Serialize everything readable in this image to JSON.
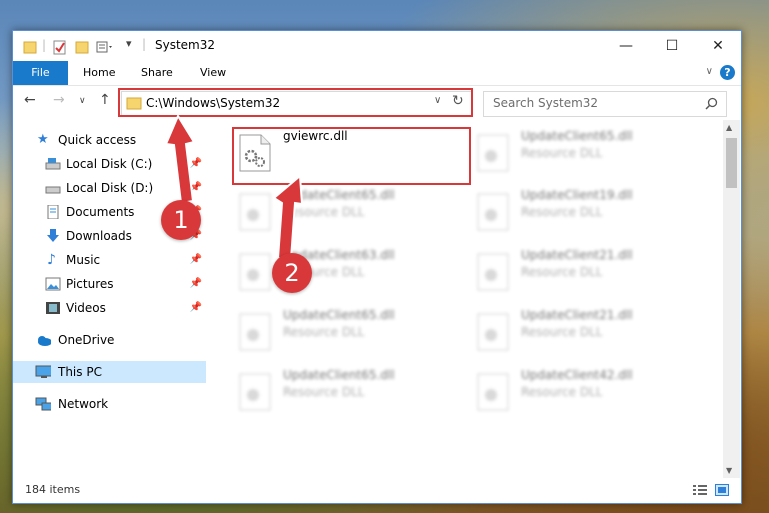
{
  "window": {
    "title": "System32"
  },
  "ribbon": {
    "file": "File",
    "tabs": [
      "Home",
      "Share",
      "View"
    ],
    "help": "?"
  },
  "address": {
    "path": "C:\\Windows\\System32"
  },
  "search": {
    "placeholder": "Search System32"
  },
  "sidebar": {
    "quick_access": "Quick access",
    "items": [
      "Local Disk (C:)",
      "Local Disk (D:)",
      "Documents",
      "Downloads",
      "Music",
      "Pictures",
      "Videos"
    ],
    "onedrive": "OneDrive",
    "this_pc": "This PC",
    "network": "Network"
  },
  "files": {
    "highlighted": {
      "name": "gviewrc.dll"
    },
    "blurred_col1": [
      {
        "name": "UpdateClient65.dll",
        "type": "Resource DLL"
      },
      {
        "name": "UpdateClient63.dll",
        "type": "Resource DLL"
      },
      {
        "name": "UpdateClient65.dll",
        "type": "Resource DLL"
      },
      {
        "name": "UpdateClient65.dll",
        "type": "Resource DLL"
      }
    ],
    "blurred_col2": [
      {
        "name": "UpdateClient65.dll",
        "type": "Resource DLL"
      },
      {
        "name": "UpdateClient19.dll",
        "type": "Resource DLL"
      },
      {
        "name": "UpdateClient21.dll",
        "type": "Resource DLL"
      },
      {
        "name": "UpdateClient21.dll",
        "type": "Resource DLL"
      },
      {
        "name": "UpdateClient42.dll",
        "type": "Resource DLL"
      }
    ]
  },
  "status": {
    "count": "184 items"
  },
  "annotations": {
    "step1": "1",
    "step2": "2"
  },
  "colors": {
    "accent": "#1979ca",
    "highlight": "#d9383a",
    "selection": "#cce8ff"
  }
}
